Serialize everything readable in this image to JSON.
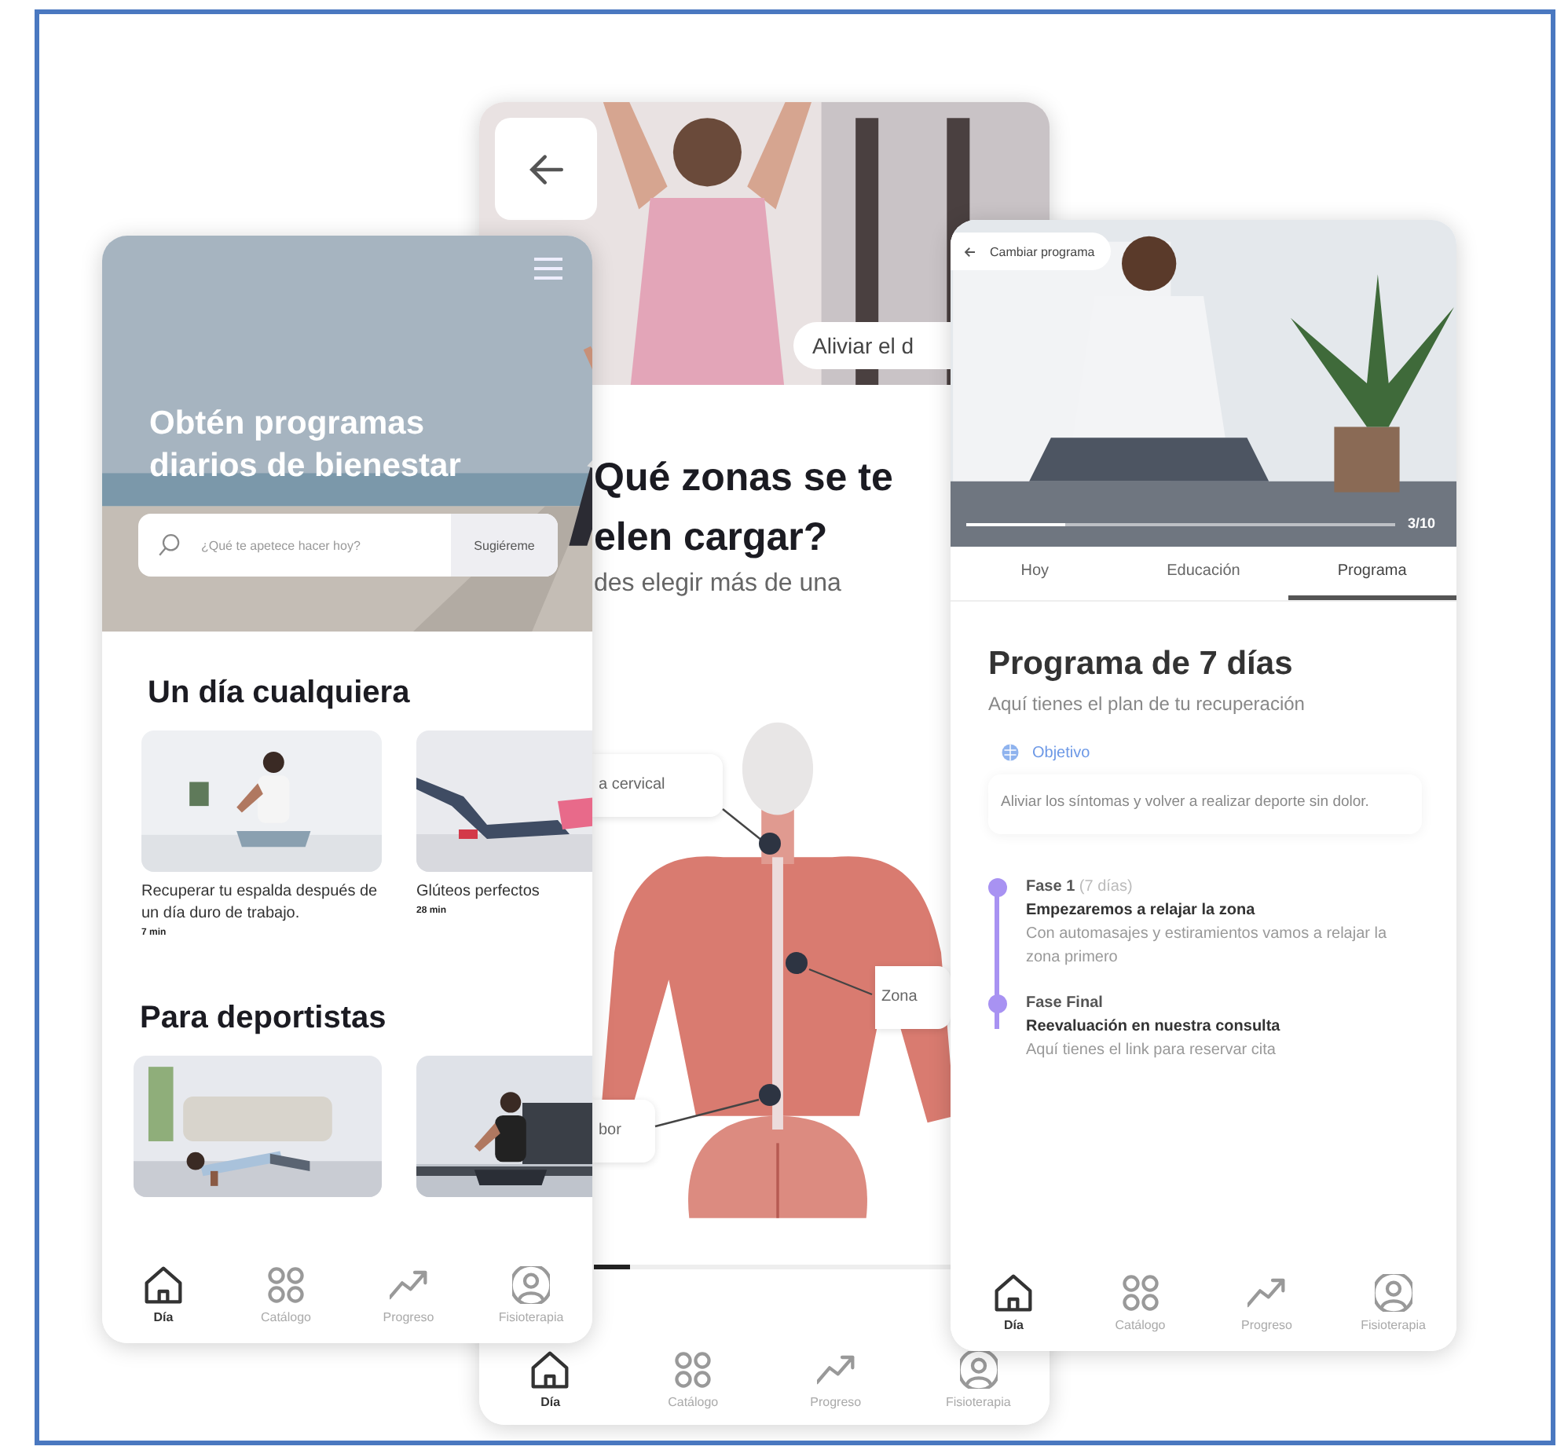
{
  "home_screen": {
    "title": "Obtén programas diarios de bienestar",
    "search": {
      "placeholder": "¿Qué te apetece hacer hoy?",
      "button": "Sugiéreme"
    },
    "sections": [
      {
        "title": "Un día cualquiera",
        "cards": [
          {
            "kind": "picture",
            "caption": "Recuperar tu espalda después de un día duro de trabajo.",
            "duration": "7 min"
          },
          {
            "kind": "picture",
            "caption": "Glúteos perfectos",
            "duration": "28 min"
          }
        ]
      },
      {
        "title": "Para deportistas"
      }
    ],
    "nav": [
      {
        "kind": "home",
        "label": "Día",
        "selected": true
      },
      {
        "kind": "catalog",
        "label": "Catálogo",
        "selected": false
      },
      {
        "kind": "progress",
        "label": "Progreso",
        "selected": false
      },
      {
        "kind": "profile",
        "label": "Fisioterapia",
        "selected": false
      }
    ]
  },
  "zones_screen": {
    "tag": "Aliviar el d",
    "title_lines": [
      "Qué zonas se te",
      "elen cargar?"
    ],
    "subtitle": "des elegir más de una",
    "zones": [
      {
        "label": "a cervical"
      },
      {
        "label": "Zona"
      },
      {
        "label": "bor"
      }
    ],
    "nav": [
      {
        "kind": "home",
        "label": "Día",
        "selected": true
      },
      {
        "kind": "catalog",
        "label": "Catálogo",
        "selected": false
      },
      {
        "kind": "progress",
        "label": "Progreso",
        "selected": false
      },
      {
        "kind": "profile",
        "label": "Fisioterapia",
        "selected": false
      }
    ]
  },
  "program_screen": {
    "back_label": "Cambiar programa",
    "video": {
      "counter": "3/10",
      "level": 0.23
    },
    "tabs": [
      {
        "label": "Hoy",
        "selected": false
      },
      {
        "label": "Educación",
        "selected": false
      },
      {
        "label": "Programa",
        "selected": true
      }
    ],
    "title": "Programa de 7 días",
    "subtitle": "Aquí tienes el plan de tu recuperación",
    "objective": {
      "label": "Objetivo",
      "text": "Aliviar los síntomas y volver a realizar deporte sin dolor."
    },
    "phases": [
      {
        "name": "Fase 1",
        "note": "(7 días)",
        "title": "Empezaremos a relajar la zona",
        "text": "Con automasajes y estiramientos vamos a relajar la zona primero"
      },
      {
        "name": "Fase Final",
        "title": "Reevaluación en nuestra consulta",
        "text": "Aquí tienes el link para reservar cita"
      }
    ],
    "nav": [
      {
        "kind": "home",
        "label": "Día",
        "selected": true
      },
      {
        "kind": "catalog",
        "label": "Catálogo",
        "selected": false
      },
      {
        "kind": "progress",
        "label": "Progreso",
        "selected": false
      },
      {
        "kind": "profile",
        "label": "Fisioterapia",
        "selected": false
      }
    ]
  }
}
